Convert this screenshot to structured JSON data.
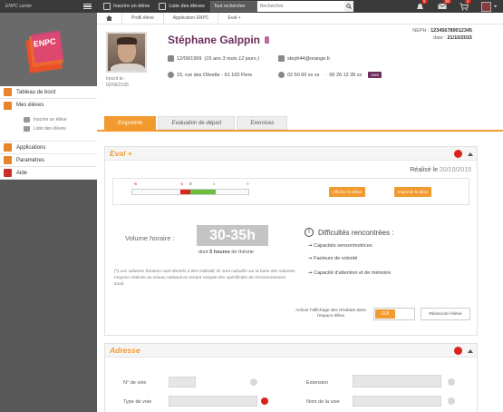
{
  "topbar": {
    "brand": "ENPC center",
    "enroll_link": "Inscrire un élève",
    "list_link": "Liste des élèves",
    "search_select": "Tout rechercher",
    "search_placeholder": "Rechercher",
    "notif_count": "5",
    "mail_count": "30",
    "cart_count": "4"
  },
  "sidebar": {
    "logo_text": "ENPC",
    "items": [
      {
        "label": "Tableau de bord",
        "icon": "dashboard-icon"
      },
      {
        "label": "Mes élèves",
        "icon": "users-icon"
      },
      {
        "label": "Applications",
        "icon": "apps-icon"
      },
      {
        "label": "Paramètres",
        "icon": "gear-icon"
      },
      {
        "label": "Aide",
        "icon": "help-icon"
      }
    ],
    "subitems": [
      {
        "label": "Inscrire un élève"
      },
      {
        "label": "Liste des élèves"
      }
    ]
  },
  "breadcrumb": [
    "Profil élève",
    "Application ENPC",
    "Eval +"
  ],
  "profile": {
    "name": "Stéphane Galppin",
    "birth": "12/09/1999",
    "age": "(15 ans 3 mois 12 jours )",
    "address": "15, rue des Olivette - 61 100 Flers",
    "email": "steph44@orange.fr",
    "phone1": "02 50 60 xx xx",
    "phone2": "06 26 12 35 xx",
    "sms": "SMS",
    "inscrit_label": "Inscrit le :",
    "inscrit_date": "02/06/2105",
    "neph_label": "NEPH :",
    "neph": "123456789012345",
    "date_label": "date :",
    "date": "21/10/2015"
  },
  "tabs": [
    "Empreinte",
    "Evaluation de départ",
    "Exercices"
  ],
  "eval": {
    "title": "Eval +",
    "realise_label": "Réalisé le",
    "realise_date": "20/10/2015",
    "scale_marks": [
      "-6",
      "-2",
      "0",
      "4",
      "9"
    ],
    "btn_detail": "Afficher le détail",
    "btn_print": "Imprimer le bilan",
    "volume_label": "Volume horaire :",
    "volume_value": "30-35h",
    "volume_sub_pre": "dont",
    "volume_sub_bold": "5 heures",
    "volume_sub_post": "de théorie",
    "note": "(*) Les volumes horaires sont donnés à titre indicatif, ils sont calculés sur la base des volumes moyens réalisés au niveau national en tenant compte des spécificités de l'environnement local.",
    "difficulties_title": "Difficultés rencontrées :",
    "difficulties": [
      "Capacités sensorimotrices",
      "Facteurs de volonté",
      "Capacité d'attention et de mémoire"
    ],
    "toggle_label": "Activer l'affichage des résultats dans l'espace élève",
    "toggle_on": "OUI",
    "reset_label": "Réinscrire l'élève"
  },
  "adresse": {
    "title": "Adresse",
    "fields": [
      "N° de voie",
      "Type de voie",
      "Extension",
      "Nom de la voie"
    ]
  },
  "colors": {
    "accent": "#f29a2e",
    "brand": "#6b2d5c",
    "danger": "#d9241c"
  }
}
